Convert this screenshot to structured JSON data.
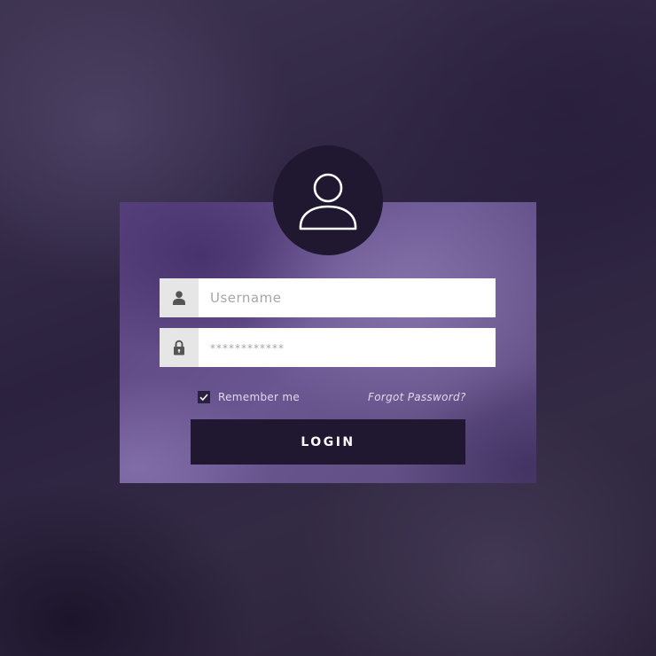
{
  "login_form": {
    "username": {
      "placeholder": "Username",
      "value": "",
      "icon": "user-icon"
    },
    "password": {
      "placeholder": "************",
      "value": "",
      "icon": "lock-icon"
    },
    "remember_me": {
      "label": "Remember me",
      "checked": true
    },
    "forgot_password_label": "Forgot Password?",
    "login_label": "LOGIN",
    "avatar_icon": "user-avatar-icon"
  },
  "colors": {
    "card_accent": "#6a5690",
    "button_background": "#1f1830",
    "avatar_background": "#201830"
  }
}
